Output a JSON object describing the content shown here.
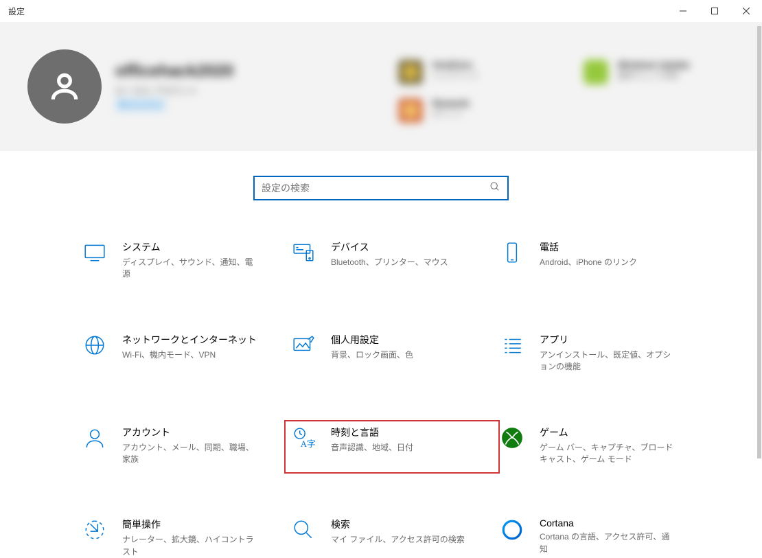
{
  "window": {
    "title": "設定"
  },
  "search": {
    "placeholder": "設定の検索"
  },
  "categories": [
    {
      "id": "system",
      "title": "システム",
      "desc": "ディスプレイ、サウンド、通知、電源"
    },
    {
      "id": "devices",
      "title": "デバイス",
      "desc": "Bluetooth、プリンター、マウス"
    },
    {
      "id": "phone",
      "title": "電話",
      "desc": "Android、iPhone のリンク"
    },
    {
      "id": "network",
      "title": "ネットワークとインターネット",
      "desc": "Wi-Fi、機内モード、VPN"
    },
    {
      "id": "personalize",
      "title": "個人用設定",
      "desc": "背景、ロック画面、色"
    },
    {
      "id": "apps",
      "title": "アプリ",
      "desc": "アンインストール、既定値、オプションの機能"
    },
    {
      "id": "accounts",
      "title": "アカウント",
      "desc": "アカウント、メール、同期、職場、家族"
    },
    {
      "id": "time",
      "title": "時刻と言語",
      "desc": "音声認識、地域、日付",
      "highlight": true
    },
    {
      "id": "gaming",
      "title": "ゲーム",
      "desc": "ゲーム バー、キャプチャ、ブロードキャスト、ゲーム モード"
    },
    {
      "id": "ease",
      "title": "簡単操作",
      "desc": "ナレーター、拡大鏡、ハイコントラスト"
    },
    {
      "id": "search",
      "title": "検索",
      "desc": "マイ ファイル、アクセス許可の検索"
    },
    {
      "id": "cortana",
      "title": "Cortana",
      "desc": "Cortana の言語、アクセス許可、通知"
    }
  ]
}
